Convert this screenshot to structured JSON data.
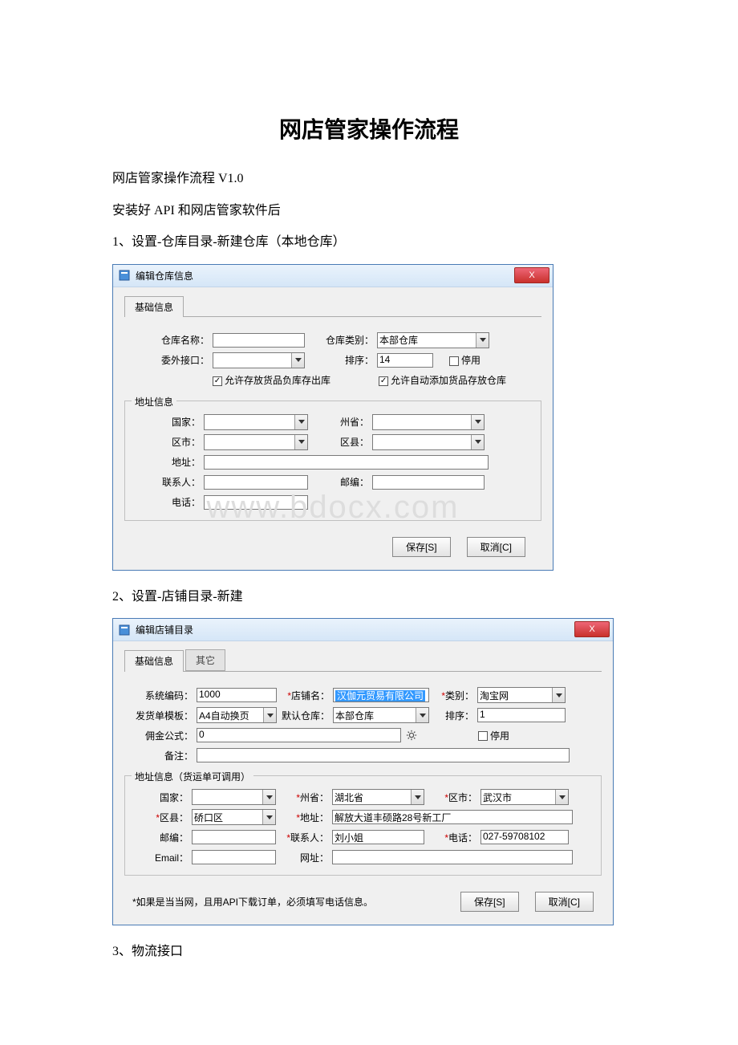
{
  "doc": {
    "title": "网店管家操作流程",
    "line_version": "网店管家操作流程 V1.0",
    "line_install": "安装好 API 和网店管家软件后",
    "step1": "1、设置-仓库目录-新建仓库（本地仓库）",
    "step2": "2、设置-店铺目录-新建",
    "step3": "3、物流接口",
    "watermark": "www.bdocx.com"
  },
  "dlg1": {
    "title": "编辑仓库信息",
    "close": "X",
    "tab_basic": "基础信息",
    "labels": {
      "name": "仓库名称：",
      "type": "仓库类别：",
      "outsource": "委外接口：",
      "order": "排序：",
      "disable": "停用",
      "allow_neg": "允许存放货品负库存出库",
      "allow_auto": "允许自动添加货品存放仓库",
      "group_addr": "地址信息",
      "country": "国家：",
      "province": "州省：",
      "city": "区市：",
      "district": "区县：",
      "address": "地址：",
      "contact": "联系人：",
      "postcode": "邮编：",
      "phone": "电话："
    },
    "values": {
      "type": "本部仓库",
      "order": "14"
    },
    "buttons": {
      "save": "保存[S]",
      "cancel": "取消[C]"
    }
  },
  "dlg2": {
    "title": "编辑店铺目录",
    "close": "X",
    "tab_basic": "基础信息",
    "tab_other": "其它",
    "labels": {
      "syscode": "系统编码：",
      "shopname": "店铺名：",
      "category": "类别：",
      "ship_tpl": "发货单模板：",
      "def_wh": "默认仓库：",
      "order": "排序：",
      "commission": "佣金公式：",
      "disable": "停用",
      "remark": "备注：",
      "group_addr": "地址信息（货运单可调用）",
      "country": "国家：",
      "province": "州省：",
      "city": "区市：",
      "district": "区县：",
      "address": "地址：",
      "postcode": "邮编：",
      "contact": "联系人：",
      "phone": "电话：",
      "email": "Email：",
      "url": "网址："
    },
    "values": {
      "syscode": "1000",
      "shopname": "汉伽元贸易有限公司",
      "category": "淘宝网",
      "ship_tpl": "A4自动换页",
      "def_wh": "本部仓库",
      "order": "1",
      "commission": "0",
      "province": "湖北省",
      "city": "武汉市",
      "district": "硚口区",
      "address": "解放大道丰硕路28号新工厂",
      "contact": "刘小姐",
      "phone": "027-59708102"
    },
    "note": "*如果是当当网，且用API下载订单，必须填写电话信息。",
    "buttons": {
      "save": "保存[S]",
      "cancel": "取消[C]"
    }
  }
}
